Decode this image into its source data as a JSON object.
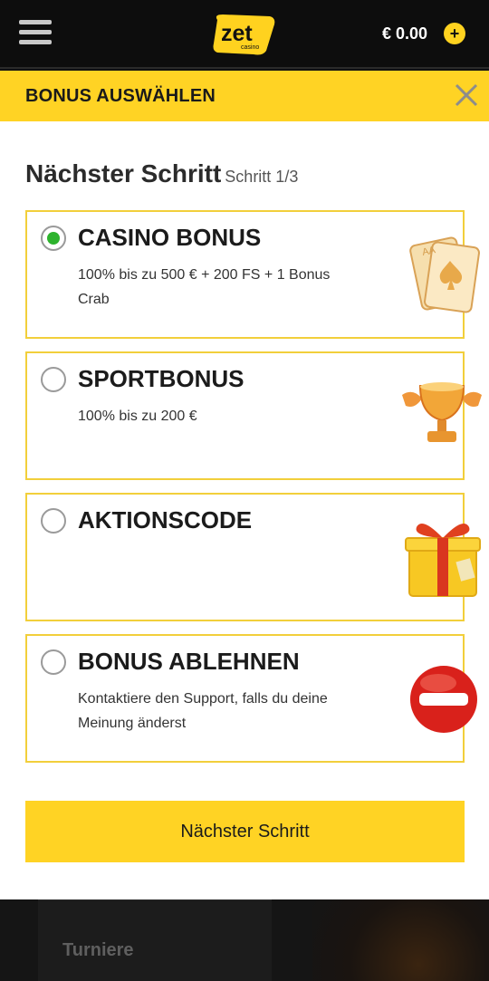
{
  "header": {
    "logo_text": "zet",
    "logo_subtext": "casino",
    "balance": "€ 0.00",
    "deposit_symbol": "+"
  },
  "modal": {
    "title": "BONUS AUSWÄHLEN",
    "step_title": "Nächster Schritt",
    "step_counter": "Schritt  1/3",
    "options": [
      {
        "title": "CASINO BONUS",
        "description": "100% bis zu 500 € + 200 FS + 1 Bonus Crab",
        "selected": true,
        "icon": "playing-cards-icon"
      },
      {
        "title": "SPORTBONUS",
        "description": "100% bis zu 200 €",
        "selected": false,
        "icon": "trophy-icon"
      },
      {
        "title": "AKTIONSCODE",
        "description": "",
        "selected": false,
        "icon": "gift-box-icon"
      },
      {
        "title": "BONUS ABLEHNEN",
        "description": "Kontaktiere den Support, falls du deine Meinung änderst",
        "selected": false,
        "icon": "no-entry-icon"
      }
    ],
    "next_button": "Nächster Schritt"
  },
  "bottom_nav": {
    "tab_label": "Turniere"
  },
  "colors": {
    "accent": "#ffd324",
    "radio_checked": "#2db32d",
    "header_bg": "#0d0d0d"
  }
}
